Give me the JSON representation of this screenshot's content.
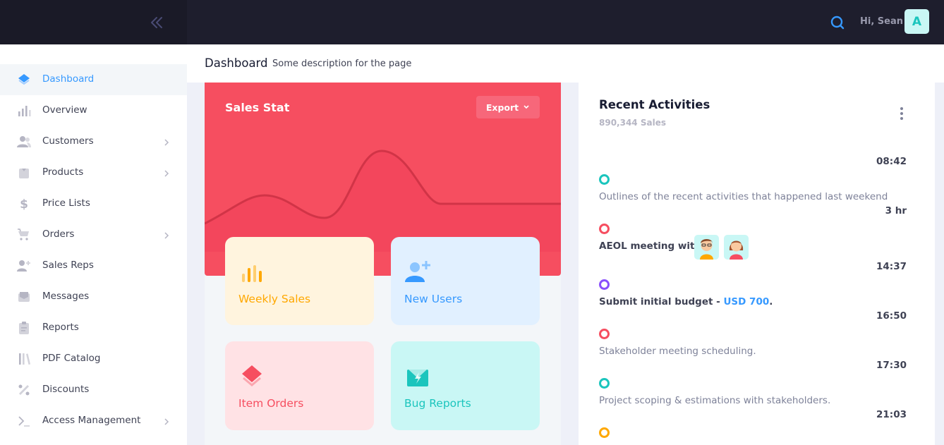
{
  "header": {
    "greeting": "Hi, Sean",
    "avatar_letter": "A"
  },
  "sidebar": {
    "items": [
      {
        "label": "Dashboard",
        "icon": "layers-icon",
        "active": true
      },
      {
        "label": "Overview",
        "icon": "bar-chart-icon"
      },
      {
        "label": "Customers",
        "icon": "users-icon",
        "has_children": true
      },
      {
        "label": "Products",
        "icon": "box-icon",
        "has_children": true
      },
      {
        "label": "Price Lists",
        "icon": "dollar-icon"
      },
      {
        "label": "Orders",
        "icon": "cart-icon",
        "has_children": true
      },
      {
        "label": "Sales Reps",
        "icon": "add-user-icon"
      },
      {
        "label": "Messages",
        "icon": "mail-icon"
      },
      {
        "label": "Reports",
        "icon": "clipboard-icon"
      },
      {
        "label": "PDF Catalog",
        "icon": "library-icon"
      },
      {
        "label": "Discounts",
        "icon": "percent-icon"
      },
      {
        "label": "Access Management",
        "icon": "terminal-icon",
        "has_children": true
      }
    ]
  },
  "subheader": {
    "title": "Dashboard",
    "description": "Some description for the page"
  },
  "sales": {
    "title": "Sales Stat",
    "export_label": "Export",
    "tiles": {
      "weekly": "Weekly Sales",
      "users": "New Users",
      "orders": "Item Orders",
      "bugs": "Bug Reports"
    }
  },
  "activities": {
    "title": "Recent Activities",
    "subtitle": "890,344 Sales",
    "items": [
      {
        "time": "08:42",
        "text": "Outlines of the recent activities that happened last weekend",
        "color": "#1bc5bd"
      },
      {
        "time": "3 hr",
        "text": "AEOL meeting with",
        "color": "#f64e60"
      },
      {
        "time": "14:37",
        "text_before": "Submit initial budget - ",
        "amount": "USD 700",
        "text_after": ".",
        "color": "#8950fc"
      },
      {
        "time": "16:50",
        "text": "Stakeholder meeting scheduling.",
        "color": "#f64e60"
      },
      {
        "time": "17:30",
        "text": "Project scoping & estimations with stakeholders.",
        "color": "#1bc5bd"
      },
      {
        "time": "21:03",
        "text": "",
        "color": "#ffa800"
      }
    ]
  },
  "colors": {
    "primary": "#3699ff",
    "danger": "#f64e60",
    "success": "#1bc5bd",
    "warning": "#ffa800",
    "info": "#8950fc",
    "dark": "#1e1e2d"
  }
}
